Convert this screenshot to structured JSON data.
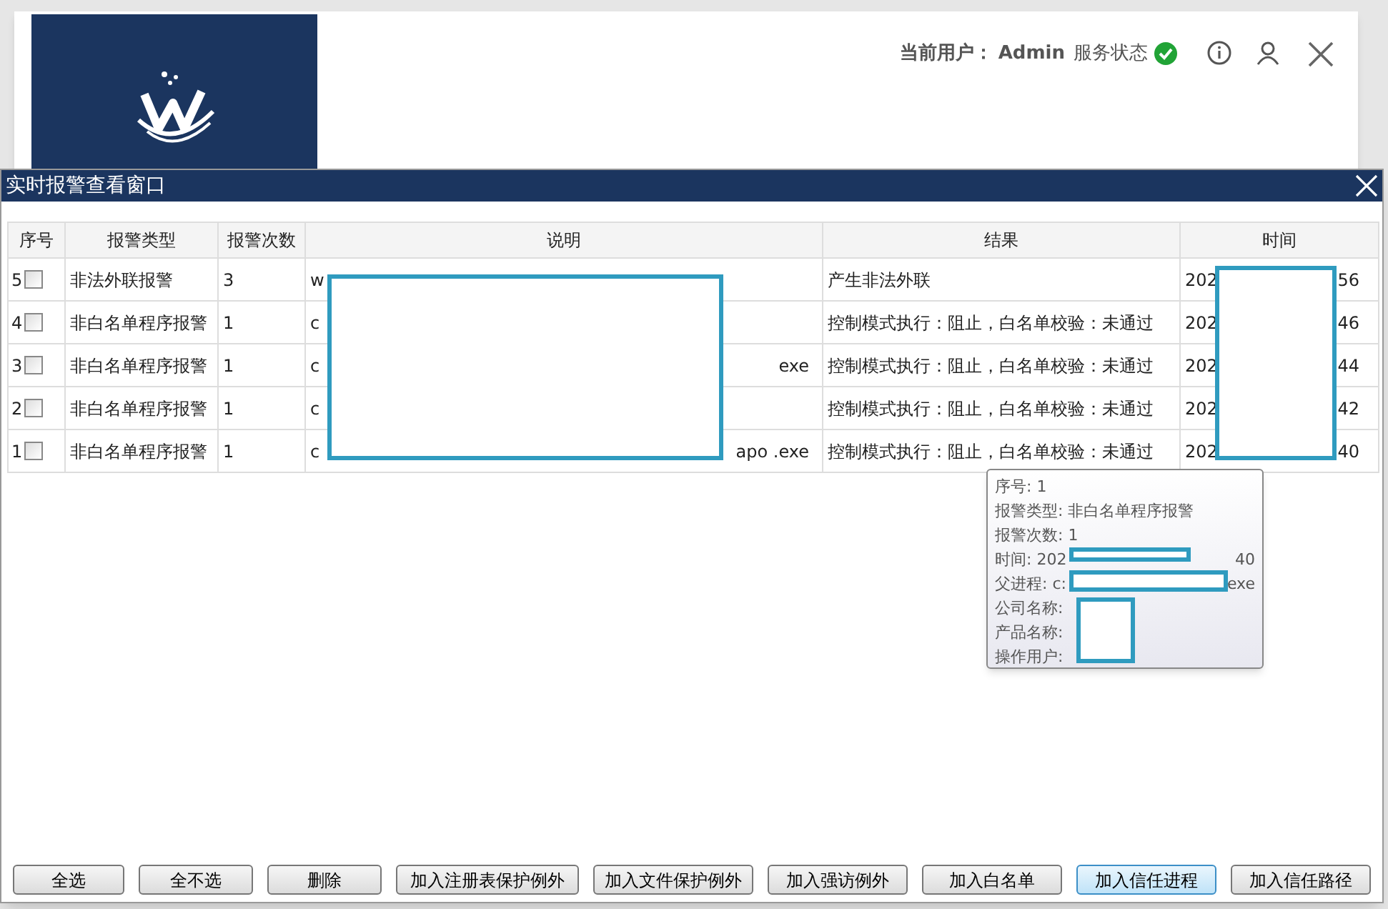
{
  "main_window": {
    "current_user_label": "当前用户：",
    "current_user": "Admin",
    "service_status_label": "服务状态",
    "service_ok": true
  },
  "dialog": {
    "title": "实时报警查看窗口"
  },
  "table": {
    "columns": [
      "序号",
      "报警类型",
      "报警次数",
      "说明",
      "结果",
      "时间"
    ],
    "rows": [
      {
        "index": "5",
        "checked": false,
        "type": "非法外联报警",
        "count": "3",
        "desc_start": "w",
        "result": "产生非法外联",
        "time_start": "202",
        "time_end": "56"
      },
      {
        "index": "4",
        "checked": false,
        "type": "非白名单程序报警",
        "count": "1",
        "desc_start": "c",
        "result": "控制模式执行：阻止，白名单校验：未通过",
        "time_start": "202",
        "time_end": "46"
      },
      {
        "index": "3",
        "checked": false,
        "type": "非白名单程序报警",
        "count": "1",
        "desc_start": "c",
        "desc_end": "exe",
        "result": "控制模式执行：阻止，白名单校验：未通过",
        "time_start": "202",
        "time_end": "44"
      },
      {
        "index": "2",
        "checked": false,
        "type": "非白名单程序报警",
        "count": "1",
        "desc_start": "c",
        "result": "控制模式执行：阻止，白名单校验：未通过",
        "time_start": "202",
        "time_end": "42"
      },
      {
        "index": "1",
        "checked": false,
        "type": "非白名单程序报警",
        "count": "1",
        "desc_start": "c",
        "desc_end": "apo .exe",
        "result": "控制模式执行：阻止，白名单校验：未通过",
        "time_start": "202",
        "time_end": "40"
      }
    ]
  },
  "tooltip": [
    {
      "text": "序号: 1"
    },
    {
      "text": "报警类型: 非白名单程序报警"
    },
    {
      "text": "报警次数: 1"
    },
    {
      "text": "时间: 202",
      "tail": "40"
    },
    {
      "text": "父进程: c:",
      "tail": "exe"
    },
    {
      "text": "公司名称:"
    },
    {
      "text": "产品名称:"
    },
    {
      "text": "操作用户:"
    }
  ],
  "buttons": [
    {
      "label": "全选",
      "focused": false
    },
    {
      "label": "全不选",
      "focused": false
    },
    {
      "label": "删除",
      "focused": false
    },
    {
      "label": "加入注册表保护例外",
      "focused": false
    },
    {
      "label": "加入文件保护例外",
      "focused": false
    },
    {
      "label": "加入强访例外",
      "focused": false
    },
    {
      "label": "加入白名单",
      "focused": false
    },
    {
      "label": "加入信任进程",
      "focused": true
    },
    {
      "label": "加入信任路径",
      "focused": false
    }
  ]
}
